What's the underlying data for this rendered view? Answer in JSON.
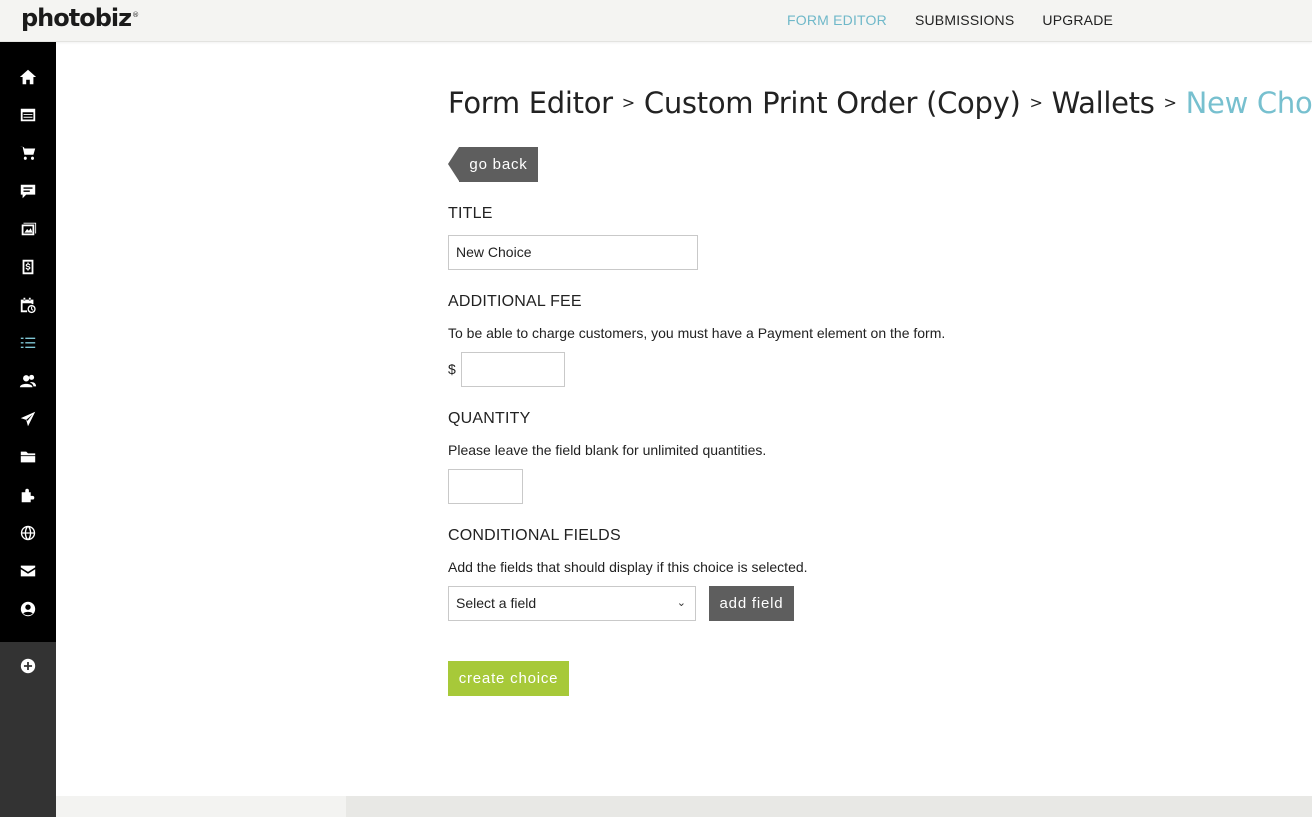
{
  "brand": {
    "logo": "photobiz",
    "logo_mark": "®"
  },
  "top_nav": [
    {
      "label": "FORM EDITOR",
      "active": true
    },
    {
      "label": "SUBMISSIONS",
      "active": false
    },
    {
      "label": "UPGRADE",
      "active": false
    }
  ],
  "sidebar": {
    "icons": [
      "home-icon",
      "website-icon",
      "cart-icon",
      "comments-icon",
      "gallery-icon",
      "invoice-icon",
      "calendar-icon",
      "forms-icon",
      "contacts-icon",
      "send-icon",
      "folder-icon",
      "plugin-icon",
      "globe-icon",
      "mail-icon",
      "account-icon",
      "add-icon"
    ]
  },
  "breadcrumb": {
    "items": [
      "Form Editor",
      "Custom Print Order (Copy)",
      "Wallets"
    ],
    "separator": ">",
    "current": "New Choice"
  },
  "go_back_label": "go back",
  "title_section": {
    "heading": "TITLE",
    "value": "New Choice"
  },
  "fee_section": {
    "heading": "ADDITIONAL FEE",
    "help": "To be able to charge customers, you must have a Payment element on the form.",
    "currency": "$",
    "value": ""
  },
  "quantity_section": {
    "heading": "QUANTITY",
    "help": "Please leave the field blank for unlimited quantities.",
    "value": ""
  },
  "conditional_section": {
    "heading": "CONDITIONAL FIELDS",
    "help": "Add the fields that should display if this choice is selected.",
    "select_value": "Select a field",
    "add_label": "add field"
  },
  "create_label": "create choice",
  "colors": {
    "accent": "#77c0cf",
    "dark_button": "#5e5e5e",
    "green_button": "#a7c939",
    "sidebar": "#000000"
  }
}
